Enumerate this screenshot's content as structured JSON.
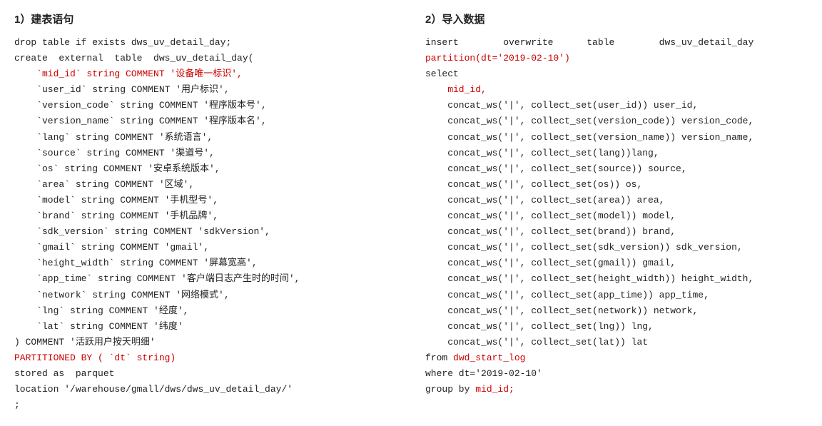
{
  "left": {
    "title": "1）建表语句",
    "lines": [
      {
        "text": "drop table if exists dws_uv_detail_day;",
        "color": "normal"
      },
      {
        "text": "create  external  table  dws_uv_detail_day(",
        "color": "normal"
      },
      {
        "text": "    `mid_id` string COMMENT '设备唯一标识',",
        "color": "red"
      },
      {
        "text": "    `user_id` string COMMENT '用户标识',",
        "color": "normal"
      },
      {
        "text": "    `version_code` string COMMENT '程序版本号',",
        "color": "normal"
      },
      {
        "text": "    `version_name` string COMMENT '程序版本名',",
        "color": "normal"
      },
      {
        "text": "    `lang` string COMMENT '系统语言',",
        "color": "normal"
      },
      {
        "text": "    `source` string COMMENT '渠道号',",
        "color": "normal"
      },
      {
        "text": "    `os` string COMMENT '安卓系统版本',",
        "color": "normal"
      },
      {
        "text": "    `area` string COMMENT '区域',",
        "color": "normal"
      },
      {
        "text": "    `model` string COMMENT '手机型号',",
        "color": "normal"
      },
      {
        "text": "    `brand` string COMMENT '手机品牌',",
        "color": "normal"
      },
      {
        "text": "    `sdk_version` string COMMENT 'sdkVersion',",
        "color": "normal"
      },
      {
        "text": "    `gmail` string COMMENT 'gmail',",
        "color": "normal"
      },
      {
        "text": "    `height_width` string COMMENT '屏幕宽高',",
        "color": "normal"
      },
      {
        "text": "    `app_time` string COMMENT '客户端日志产生时的时间',",
        "color": "normal"
      },
      {
        "text": "    `network` string COMMENT '网络模式',",
        "color": "normal"
      },
      {
        "text": "    `lng` string COMMENT '经度',",
        "color": "normal"
      },
      {
        "text": "    `lat` string COMMENT '纬度'",
        "color": "normal"
      },
      {
        "text": ") COMMENT '活跃用户按天明细'",
        "color": "normal"
      },
      {
        "text": "PARTITIONED BY ( `dt` string)",
        "color": "red"
      },
      {
        "text": "stored as  parquet",
        "color": "normal"
      },
      {
        "text": "location '/warehouse/gmall/dws/dws_uv_detail_day/'",
        "color": "normal"
      },
      {
        "text": ";",
        "color": "normal"
      }
    ]
  },
  "right": {
    "title": "2）导入数据",
    "lines": [
      {
        "text": "insert        overwrite      table        dws_uv_detail_day",
        "color": "normal"
      },
      {
        "text": "partition(dt='2019-02-10')",
        "color": "red"
      },
      {
        "text": "select",
        "color": "normal"
      },
      {
        "text": "    mid_id,",
        "color": "red"
      },
      {
        "text": "    concat_ws('|', collect_set(user_id)) user_id,",
        "color": "normal"
      },
      {
        "text": "    concat_ws('|', collect_set(version_code)) version_code,",
        "color": "normal"
      },
      {
        "text": "    concat_ws('|', collect_set(version_name)) version_name,",
        "color": "normal"
      },
      {
        "text": "    concat_ws('|', collect_set(lang))lang,",
        "color": "normal"
      },
      {
        "text": "    concat_ws('|', collect_set(source)) source,",
        "color": "normal"
      },
      {
        "text": "    concat_ws('|', collect_set(os)) os,",
        "color": "normal"
      },
      {
        "text": "    concat_ws('|', collect_set(area)) area,",
        "color": "normal"
      },
      {
        "text": "    concat_ws('|', collect_set(model)) model,",
        "color": "normal"
      },
      {
        "text": "    concat_ws('|', collect_set(brand)) brand,",
        "color": "normal"
      },
      {
        "text": "    concat_ws('|', collect_set(sdk_version)) sdk_version,",
        "color": "normal"
      },
      {
        "text": "    concat_ws('|', collect_set(gmail)) gmail,",
        "color": "normal"
      },
      {
        "text": "    concat_ws('|', collect_set(height_width)) height_width,",
        "color": "normal"
      },
      {
        "text": "    concat_ws('|', collect_set(app_time)) app_time,",
        "color": "normal"
      },
      {
        "text": "    concat_ws('|', collect_set(network)) network,",
        "color": "normal"
      },
      {
        "text": "    concat_ws('|', collect_set(lng)) lng,",
        "color": "normal"
      },
      {
        "text": "    concat_ws('|', collect_set(lat)) lat",
        "color": "normal"
      },
      {
        "text": "from dwd_start_log",
        "color": "normal",
        "inline_red": "dwd_start_log",
        "prefix": "from ",
        "suffix": ""
      },
      {
        "text": "where dt='2019-02-10'",
        "color": "normal"
      },
      {
        "text": "group by mid_id;",
        "color": "normal",
        "inline_red": "mid_id;",
        "prefix": "group by ",
        "suffix": ""
      }
    ]
  }
}
